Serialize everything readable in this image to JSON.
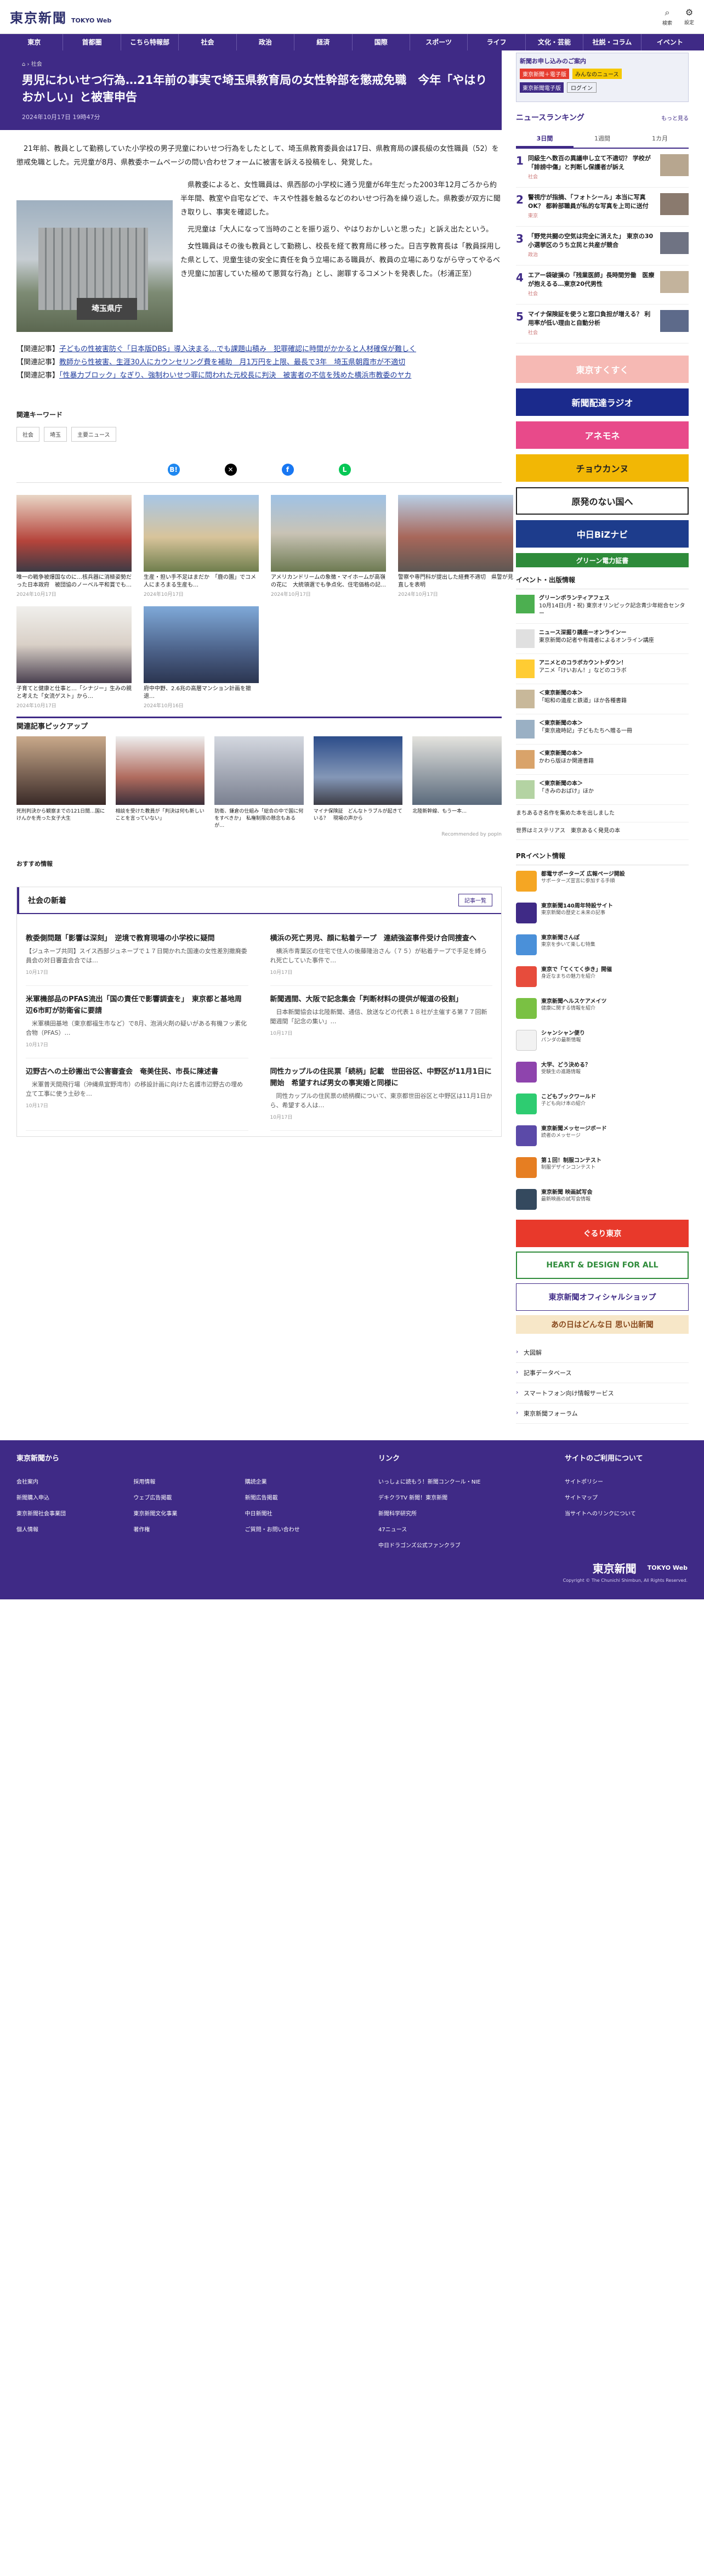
{
  "header": {
    "logo_ja": "東京新聞",
    "logo_en": "TOKYO Web",
    "search": "検索",
    "settings": "設定"
  },
  "nav": [
    "東京",
    "首都圏",
    "こちら特報部",
    "社会",
    "政治",
    "経済",
    "国際",
    "スポーツ",
    "ライフ",
    "文化・芸能",
    "社説・コラム",
    "イベント"
  ],
  "article": {
    "crumb": "社会",
    "title": "男児にわいせつ行為…21年前の事実で埼玉県教育局の女性幹部を懲戒免職　今年「やはりおかしい」と被害申告",
    "date": "2024年10月17日 19時47分",
    "lead": "　21年前、教員として勤務していた小学校の男子児童にわいせつ行為をしたとして、埼玉県教育委員会は17日、県教育局の課長級の女性職員（52）を懲戒免職とした。元児童が8月、県教委ホームページの問い合わせフォームに被害を訴える投稿をし、発覚した。",
    "p1": "　県教委によると、女性職員は、県西部の小学校に通う児童が6年生だった2003年12月ごろから約半年間、教室や自宅などで、キスや性器を触るなどのわいせつ行為を繰り返した。県教委が双方に聞き取りし、事実を確認した。",
    "p2": "　元児童は「大人になって当時のことを振り返り、やはりおかしいと思った」と訴え出たという。",
    "p3": "　女性職員はその後も教員として勤務し、校長を経て教育局に移った。日吉亨教育長は「教員採用した県として、児童生徒の安全に責任を負う立場にある職員が、教員の立場にありながら守ってやるべき児童に加害していた極めて悪質な行為」とし、謝罪するコメントを発表した。（杉浦正至）",
    "photo_sign": "埼玉県庁",
    "rel_label": "【関連記事】",
    "rel": [
      "子どもの性被害防ぐ「日本版DBS」導入決まる…でも課題山積み　犯罪確認に時間がかかると人材確保が難しく",
      "教師から性被害、生涯30人にカウンセリング費を補助　月1万円を上限、最長で3年　埼玉県朝霞市が不適切",
      "「性暴力ブロック」なぎり、強制わいせつ罪に問われた元校長に判決　被害者の不信を残めた横浜市教委のヤカ"
    ]
  },
  "keywords": {
    "label": "関連キーワード",
    "items": [
      "社会",
      "埼玉",
      "主要ニュース"
    ]
  },
  "cards": [
    {
      "t": "唯一の戦争被爆国なのに…核兵器に消極姿勢だった日本政府　被団協のノーベル平和賞でも…",
      "d": "2024年10月17日"
    },
    {
      "t": "生産・担い手不足はまだか　「鹿の園」でコメ人にまろまる生産も…",
      "d": "2024年10月17日"
    },
    {
      "t": "アメリカンドリームの象徴・マイホームが高嶺の花に　大統領選でも争点化、住宅価格の記…",
      "d": "2024年10月17日"
    },
    {
      "t": "警察や専門科が提出した経費不適切　県警が見直しを表明",
      "d": "2024年10月17日"
    },
    {
      "t": "子育てと健康と仕事と…「シナジー」生みの親と考えた「女流ゲスト」から…",
      "d": "2024年10月17日"
    },
    {
      "t": "府中中野、2.6兆の高層マンション計画を撤退…",
      "d": "2024年10月16日"
    }
  ],
  "pick": {
    "label": "関連記事ピックアップ",
    "items": [
      "死刑判決から観察までの121日間…国にけんかを売った女子大生",
      "相談を受けた教員が「判決は何も新しいことを言っていない」",
      "防衛、鎌倉の仕組み「総合の中で国に何をすべきか」　私権制限の懸念もあるが…",
      "マイナ保険証　どんなトラブルが起きている？　現場の声から",
      "北陸新幹線、もう一本…"
    ],
    "rec": "Recommended by",
    "rec_brand": "popIn"
  },
  "osusume": "おすすめ情報",
  "news": {
    "label": "社会の新着",
    "more": "記事一覧",
    "items": [
      {
        "h": "教委側問題「影響は深刻」　逆境で教育現場の小学校に疑問",
        "p": "【ジュネーブ共同】スイス西部ジュネーブで１７日開かれた国連の女性差別撤廃委員会の対日審査会合では…",
        "d": "10月17日"
      },
      {
        "h": "横浜の死亡男児、顔に粘着テープ　連続強盗事件受け合同捜査へ",
        "p": "　横浜市青葉区の住宅で住人の後藤隆治さん（７５）が粘着テープで手足を縛られ死亡していた事件で…",
        "d": "10月17日"
      },
      {
        "h": "米軍機部品のPFAS流出「国の責任で影響調査を」　東京都と基地周辺6市町が防衛省に要請",
        "p": "　米軍横田基地（東京都福生市など）で8月、泡消火剤の疑いがある有機フッ素化合物（PFAS）…",
        "d": "10月17日"
      },
      {
        "h": "新聞週間、大阪で記念集会「判断材料の提供が報道の役割」",
        "p": "　日本新聞協会は北陸新聞、通信、放送などの代表１８社が主催する第７７回新聞週間「記念の集い」…",
        "d": "10月17日"
      },
      {
        "h": "辺野古への土砂搬出で公害審査会　奄美住民、市長に陳述書",
        "p": "　米軍普天間飛行場（沖縄県宜野湾市）の移設計画に向けた名護市辺野古の埋め立て工事に使う土砂を…",
        "d": "10月17日"
      },
      {
        "h": "同性カップルの住民票「続柄」記載　世田谷区、中野区が11月1日に開始　希望すれば男女の事実婚と同様に",
        "p": "　同性カップルの住民票の続柄欄について、東京都世田谷区と中野区は11月1日から、希望する人は…",
        "d": "10月17日"
      }
    ]
  },
  "side": {
    "ad_head": "新聞お申し込みのご案内",
    "ad_a": "東京新聞＋電子版",
    "ad_b": "みんなのニュース",
    "ad_c": "東京新聞電子版",
    "ad_login": "ログイン",
    "rank_label": "ニュースランキング",
    "rank_more": "もっと見る",
    "tabs": [
      "3日間",
      "1週間",
      "1カ月"
    ],
    "rank": [
      {
        "t": "同級生へ数百の異議申し立て不適切？ 学校が「誹謗中傷」と判断し保護者が訴え",
        "c": "社会"
      },
      {
        "t": "警視庁が指摘、「フォトシール」本当に写真OK？ 都幹部職員が私的な写真を上司に送付",
        "c": "東京"
      },
      {
        "t": "「野党共闘の空気は完全に消えた」 東京の30小選挙区のうち立民と共産が競合",
        "c": "政治"
      },
      {
        "t": "エアー袋破損の「残業医師」長時間労働　医療が抱えるる…東京20代男性",
        "c": "社会"
      },
      {
        "t": "マイナ保険証を使うと窓口負担が増える？ 利用率が低い理由と自動分析",
        "c": "社会"
      }
    ],
    "banners": [
      "東京すくすく",
      "新聞配達ラジオ",
      "アネモネ",
      "チョウカンヌ",
      "原発のない国へ",
      "中日BiZナビ",
      "グリーン電力証書"
    ],
    "ev_label": "イベント・出版情報",
    "ev": [
      {
        "b": "グリーンボランティアフェス",
        "t": "10月14日(月・祝) 東京オリンピック記念青少年総合センター"
      },
      {
        "b": "ニュース深掘り講座ーオンラインー",
        "t": "東京新聞の記者や有識者によるオンライン講座"
      },
      {
        "b": "アニメとのコラボカウントダウン！",
        "t": "アニメ「けいおん！」などのコラボ"
      },
      {
        "b": "＜東京新聞の本＞",
        "t": "「昭和の遺産と鉄道」ほか各種書籍"
      },
      {
        "b": "＜東京新聞の本＞",
        "t": "「東京歳時記」子どもたちへ贈る一冊"
      },
      {
        "b": "＜東京新聞の本＞",
        "t": "かわら版ほか関連書籍"
      },
      {
        "b": "＜東京新聞の本＞",
        "t": "「きみのおばけ」ほか"
      }
    ],
    "ev_text": [
      "まちあるき名作を集めた本を出しました",
      "世界はミステリアス　東京あるく発見の本"
    ],
    "pr_label": "PRイベント情報",
    "pr": [
      {
        "b": "都電サポーターズ 広報ページ開設",
        "t": "サポーターズ宣言に参加する手順"
      },
      {
        "b": "東京新聞140周年特設サイト",
        "t": "東京新聞の歴史と未来の記事"
      },
      {
        "b": "東京新聞さんぽ",
        "t": "東京を歩いて楽しむ特集"
      },
      {
        "b": "東京で「てくてく歩き」開催",
        "t": "身近なまちの魅力を紹介"
      },
      {
        "b": "東京新聞ヘルスケアメイツ",
        "t": "健康に関する情報を紹介"
      },
      {
        "b": "シャンシャン便り",
        "t": "パンダの最新情報"
      },
      {
        "b": "大学、どう決める？",
        "t": "受験生の進路情報"
      },
      {
        "b": "こどもブックワールド",
        "t": "子ども向け本の紹介"
      },
      {
        "b": "東京新聞メッセージボード",
        "t": "読者のメッセージ"
      },
      {
        "b": "第１回！制服コンテスト",
        "t": "制服デザインコンテスト"
      },
      {
        "b": "東京新聞 映画試写会",
        "t": "最新映画の試写会情報"
      }
    ],
    "sbn": [
      "ぐるり東京",
      "HEART & DESIGN FOR ALL",
      "東京新聞オフィシャルショップ",
      "あの日はどんな日 思い出新聞"
    ],
    "links": [
      "大図解",
      "記事データベース",
      "スマートフォン向け情報サービス",
      "東京新聞フォーラム"
    ]
  },
  "footer": {
    "c1": "東京新聞から",
    "c1_items": [
      "会社案内",
      "採用情報",
      "購読企業",
      "新聞購入申込",
      "ウェブ広告掲載",
      "新聞広告掲載",
      "東京新聞社会事業団",
      "東京新聞文化事業",
      "中日新聞社",
      "個人情報",
      "著作権",
      "ご質問・お問い合わせ"
    ],
    "c2": "リンク",
    "c2_items": [
      "いっしょに読もう！新聞コンクール・NIE",
      "デキクラTV 新聞！東京新聞",
      "新聞科学研究所",
      "47ニュース",
      "中日ドラゴンズ公式ファンクラブ"
    ],
    "c3": "サイトのご利用について",
    "c3_items": [
      "サイトポリシー",
      "サイトマップ",
      "当サイトへのリンクについて"
    ],
    "logo": "東京新聞",
    "logo_en": "TOKYO Web",
    "copy": "Copyright © The Chunichi Shimbun, All Rights Reserved."
  }
}
